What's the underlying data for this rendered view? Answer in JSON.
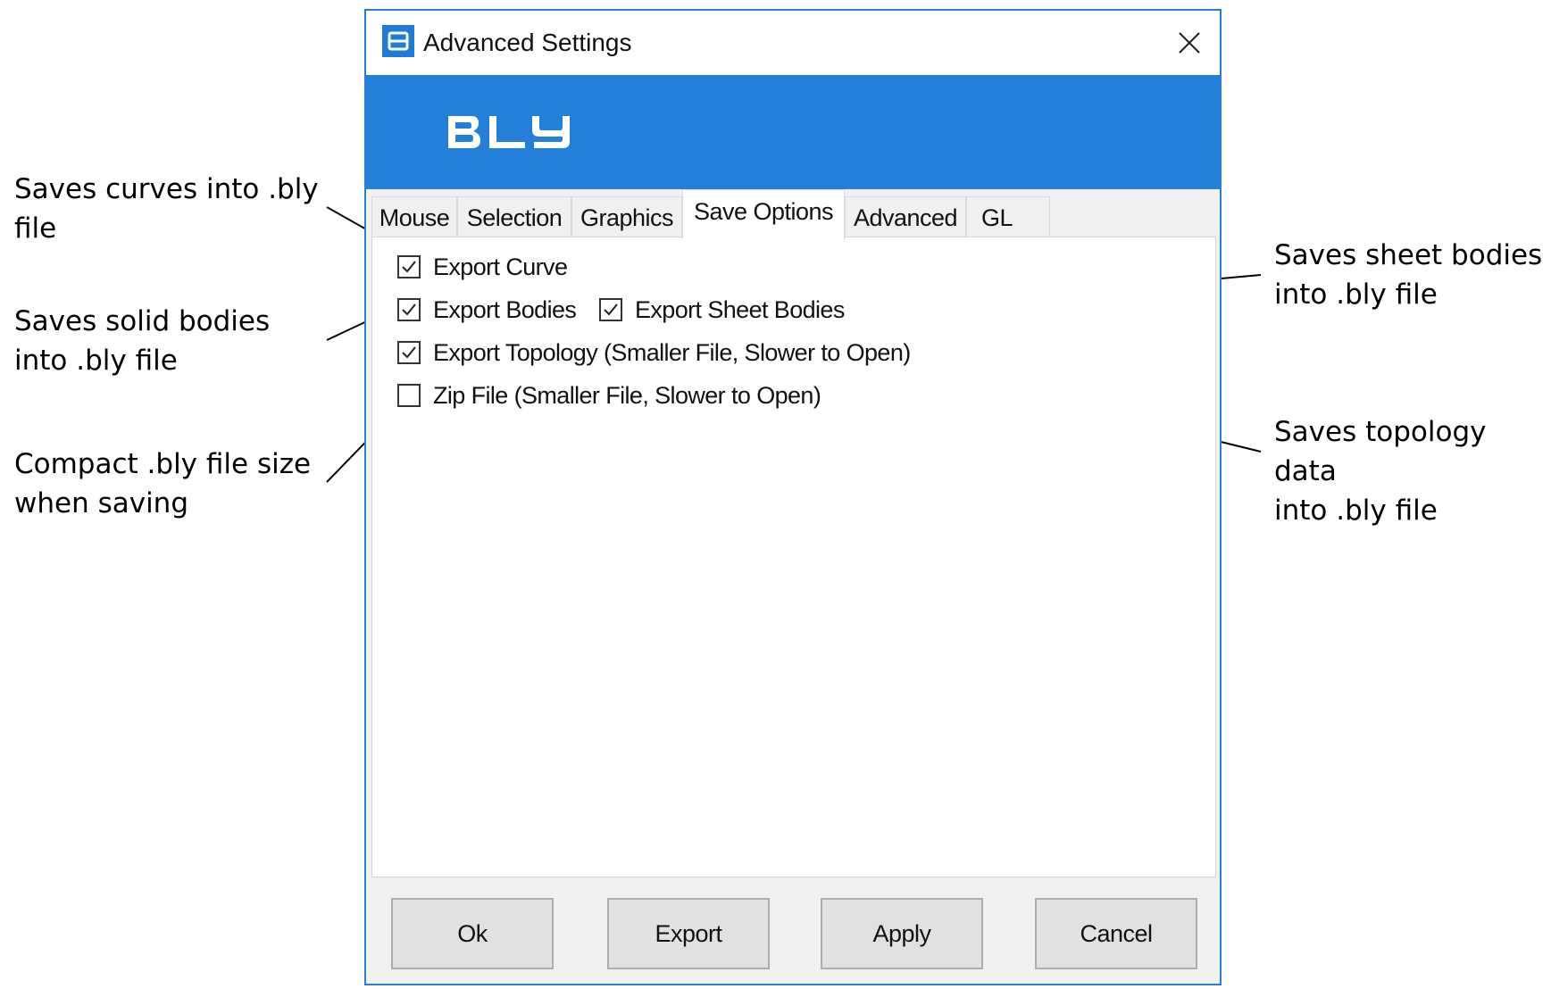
{
  "window": {
    "title": "Advanced Settings",
    "icon": "app-b-icon",
    "accent_color": "#247fd9"
  },
  "banner": {
    "logo_text": "BLY"
  },
  "tabs": [
    {
      "label": "Mouse",
      "active": false
    },
    {
      "label": "Selection",
      "active": false
    },
    {
      "label": "Graphics",
      "active": false
    },
    {
      "label": "Save Options",
      "active": true
    },
    {
      "label": "Advanced",
      "active": false
    },
    {
      "label": "GL",
      "active": false
    }
  ],
  "options": [
    {
      "label": "Export Curve",
      "checked": true
    },
    {
      "label": "Export Bodies",
      "checked": true
    },
    {
      "label": "Export Sheet Bodies",
      "checked": true
    },
    {
      "label": "Export Topology (Smaller File, Slower to Open)",
      "checked": true
    },
    {
      "label": "Zip File (Smaller File, Slower to Open)",
      "checked": false
    }
  ],
  "buttons": {
    "ok": "Ok",
    "export": "Export",
    "apply": "Apply",
    "cancel": "Cancel"
  },
  "annotations": {
    "export_curve": "Saves curves into .bly\nfile",
    "export_bodies": "Saves solid bodies\ninto .bly file",
    "zip_file": "Compact .bly file size\nwhen saving",
    "export_sheet_bodies": "Saves sheet bodies\ninto .bly file",
    "export_topology": "Saves topology data\ninto .bly file"
  }
}
